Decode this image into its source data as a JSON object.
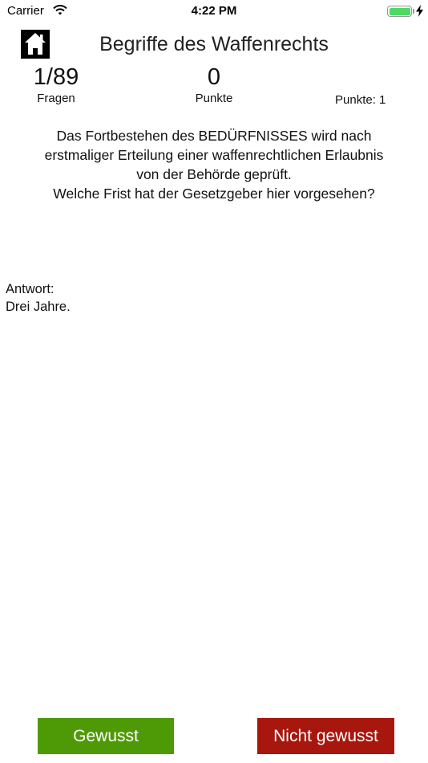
{
  "status_bar": {
    "carrier": "Carrier",
    "time": "4:22 PM",
    "battery_level": 1.0,
    "charging": true
  },
  "header": {
    "title": "Begriffe des Waffenrechts",
    "home_icon": "home-icon"
  },
  "stats": {
    "questions_value": "1/89",
    "questions_label": "Fragen",
    "points_value": "0",
    "points_label": "Punkte",
    "points_per_question": "Punkte: 1"
  },
  "question": {
    "lines": [
      "Das Fortbestehen des BEDÜRFNISSES wird nach",
      "erstmaliger Erteilung einer waffenrechtlichen Erlaubnis",
      "von der Behörde geprüft.",
      "Welche Frist hat der Gesetzgeber hier vorgesehen?"
    ]
  },
  "answer": {
    "label": "Antwort:",
    "text": "Drei Jahre."
  },
  "buttons": {
    "known_label": "Gewusst",
    "unknown_label": "Nicht gewusst",
    "known_color": "#4e9a06",
    "unknown_color": "#a8170e"
  }
}
